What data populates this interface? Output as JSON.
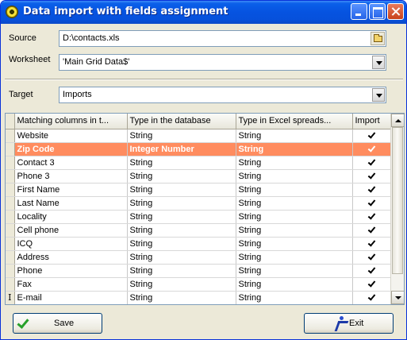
{
  "window": {
    "title": "Data import with fields assignment"
  },
  "source": {
    "label": "Source",
    "value": "D:\\contacts.xls"
  },
  "worksheet": {
    "label": "Worksheet",
    "value": "'Main Grid Data$'"
  },
  "target": {
    "label": "Target",
    "value": "Imports"
  },
  "grid": {
    "columns": [
      "Matching columns in t...",
      "Type in the database",
      "Type in Excel spreads...",
      "Import"
    ],
    "rows": [
      {
        "name": "Website",
        "db_type": "String",
        "excel_type": "String",
        "import": true
      },
      {
        "name": "Zip Code",
        "db_type": "Integer Number",
        "excel_type": "String",
        "import": true,
        "selected": true
      },
      {
        "name": "Contact 3",
        "db_type": "String",
        "excel_type": "String",
        "import": true
      },
      {
        "name": "Phone 3",
        "db_type": "String",
        "excel_type": "String",
        "import": true
      },
      {
        "name": "First Name",
        "db_type": "String",
        "excel_type": "String",
        "import": true
      },
      {
        "name": "Last Name",
        "db_type": "String",
        "excel_type": "String",
        "import": true
      },
      {
        "name": "Locality",
        "db_type": "String",
        "excel_type": "String",
        "import": true
      },
      {
        "name": "Cell phone",
        "db_type": "String",
        "excel_type": "String",
        "import": true
      },
      {
        "name": "ICQ",
        "db_type": "String",
        "excel_type": "String",
        "import": true
      },
      {
        "name": "Address",
        "db_type": "String",
        "excel_type": "String",
        "import": true
      },
      {
        "name": "Phone",
        "db_type": "String",
        "excel_type": "String",
        "import": true
      },
      {
        "name": "Fax",
        "db_type": "String",
        "excel_type": "String",
        "import": true
      },
      {
        "name": "E-mail",
        "db_type": "String",
        "excel_type": "String",
        "import": true
      }
    ],
    "row_indicator": "I"
  },
  "buttons": {
    "save_label": "Save",
    "exit_label": "Exit"
  },
  "colors": {
    "selected_row": "#ff8c5f",
    "titlebar": "#0653e0",
    "dialog_bg": "#ece9d8"
  }
}
